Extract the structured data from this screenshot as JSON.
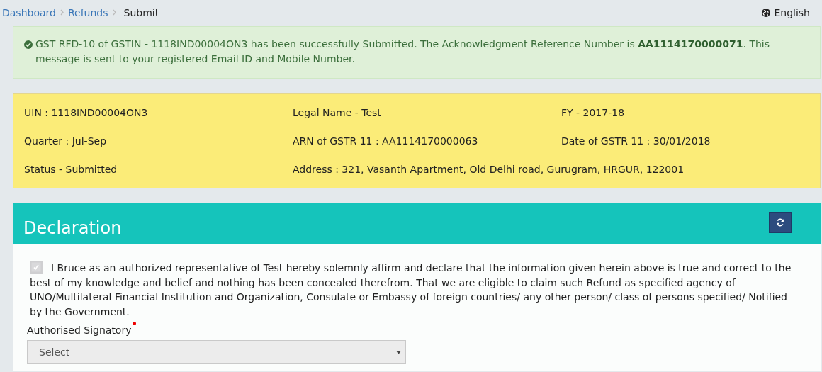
{
  "breadcrumb": [
    {
      "label": "Dashboard",
      "kind": "link"
    },
    {
      "label": "Refunds",
      "kind": "link"
    },
    {
      "label": "Submit",
      "kind": "current"
    }
  ],
  "language": "English",
  "alert": {
    "message": "GST RFD-10 of GSTIN - 1118IND00004ON3 has been successfully Submitted. The Acknowledgment Reference Number is **AA1114170000071**. This message is sent to your registered Email ID and Mobile Number."
  },
  "details": [
    [
      "UIN : 1118IND00004ON3",
      "Legal Name - Test",
      "FY - 2017-18"
    ],
    [
      "Quarter : Jul-Sep",
      "ARN of GSTR 11 : AA1114170000063",
      "Date of GSTR 11 : 30/01/2018"
    ],
    [
      "Status - Submitted",
      "Address : 321, Vasanth Apartment, Old Delhi road, Gurugram, HRGUR, 122001"
    ]
  ],
  "declaration": {
    "title": "Declaration",
    "statement": {
      "checked": true,
      "disabled": true,
      "text": "I Bruce as an authorized representative of Test hereby solemnly affirm and declare that the information given herein above is true and correct to the best of my knowledge and belief and nothing has been concealed therefrom. That we are eligible to claim such Refund as specified agency of UNO/Multilateral Financial Institution and Organization, Consulate or Embassy of foreign countries/ any other person/ class of persons specified/ Notified by the Government."
    },
    "signatory": {
      "label": "Authorised Signatory",
      "required": true,
      "value": "Select"
    }
  }
}
